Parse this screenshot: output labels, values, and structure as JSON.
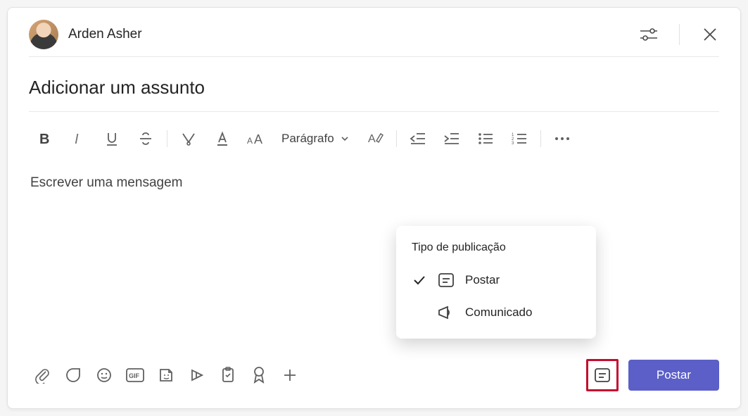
{
  "header": {
    "username": "Arden Asher"
  },
  "subject": {
    "placeholder": "Adicionar um assunto",
    "value": ""
  },
  "toolbar": {
    "paragraph_label": "Parágrafo"
  },
  "message": {
    "placeholder": "Escrever uma mensagem"
  },
  "popup": {
    "title": "Tipo de publicação",
    "items": [
      {
        "label": "Postar",
        "selected": true
      },
      {
        "label": "Comunicado",
        "selected": false
      }
    ]
  },
  "actions": {
    "post_button": "Postar"
  }
}
